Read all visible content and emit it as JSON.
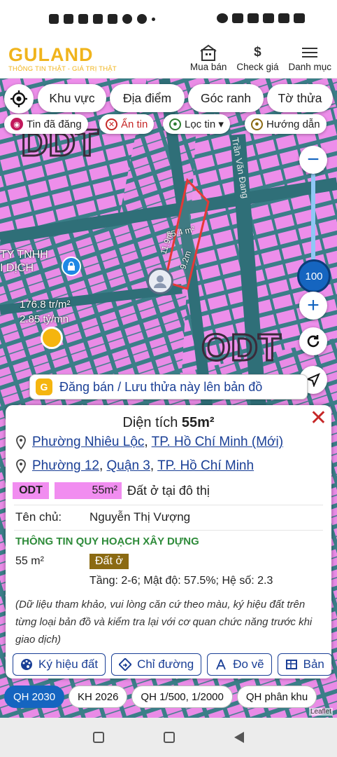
{
  "header": {
    "logo": "GULAND",
    "tagline": "THÔNG TIN THẬT - GIÁ TRỊ THẬT",
    "nav": [
      {
        "label": "Mua bán",
        "icon": "building-icon"
      },
      {
        "label": "Check giá",
        "icon": "dollar-icon"
      },
      {
        "label": "Danh mục",
        "icon": "menu-icon"
      }
    ]
  },
  "toolbar": {
    "locate_icon": "crosshair-icon",
    "buttons": [
      "Khu vực",
      "Địa điểm",
      "Góc ranh",
      "Tờ thửa"
    ]
  },
  "filters": [
    {
      "label": "Tin đã đăng",
      "icon": "palette-icon",
      "color": "#c2185b"
    },
    {
      "label": "Ẩn tin",
      "icon": "close-circle-icon",
      "color": "#c62828"
    },
    {
      "label": "Lọc tin ▾",
      "icon": "location-pin-icon",
      "color": "#2e7d32"
    },
    {
      "label": "Hướng dẫn",
      "icon": "play-circle-icon",
      "color": "#8b6a12"
    }
  ],
  "map": {
    "parcel_labels": {
      "area": "55.4 m²",
      "width": "11.9m",
      "depth": "9.2m"
    },
    "company_label": "TY TNHH\nI DỊCH",
    "zone_label": "ODT",
    "price_line1": "176.8 tr/m²",
    "price_line2": "2.85 tỷ/mn",
    "zoom_level": "100",
    "banner": "Đăng bán / Lưu thửa này lên bản đồ",
    "street": "Trần Văn Đang"
  },
  "panel": {
    "title_prefix": "Diện tích",
    "title_value": "55m²",
    "address1_parts": [
      "Phường Nhiêu Lộc",
      "TP. Hồ Chí Minh (Mới)"
    ],
    "address2_parts": [
      "Phường 12",
      "Quận 3",
      "TP. Hồ Chí Minh"
    ],
    "land_code": "ODT",
    "land_area": "55m²",
    "land_type": "Đất ở tại đô thị",
    "owner_label": "Tên chủ:",
    "owner_name": "Nguyễn Thị Vượng",
    "planning_title": "THÔNG TIN QUY HOẠCH XÂY DỰNG",
    "planning_area": "55 m²",
    "planning_badge": "Đất ở",
    "planning_detail": "Tầng: 2-6; Mật độ: 57.5%; Hệ số: 2.3",
    "note": "(Dữ liệu tham khảo, vui lòng căn cứ theo màu, ký hiệu đất trên từng loại bản đồ và kiểm tra lại với cơ quan chức năng trước khi giao dịch)",
    "tools": [
      "Ký hiệu đất",
      "Chỉ đường",
      "Đo vẽ",
      "Bản"
    ]
  },
  "chips": [
    {
      "label": "QH 2030",
      "active": true
    },
    {
      "label": "KH 2026",
      "active": false
    },
    {
      "label": "QH 1/500, 1/2000",
      "active": false
    },
    {
      "label": "QH phân khu",
      "active": false
    }
  ],
  "attribution": "Leaflet",
  "colors": {
    "accent": "#1565c0",
    "brand": "#f0b41c",
    "land_pink": "#f18df0",
    "road": "#3b7e88"
  }
}
